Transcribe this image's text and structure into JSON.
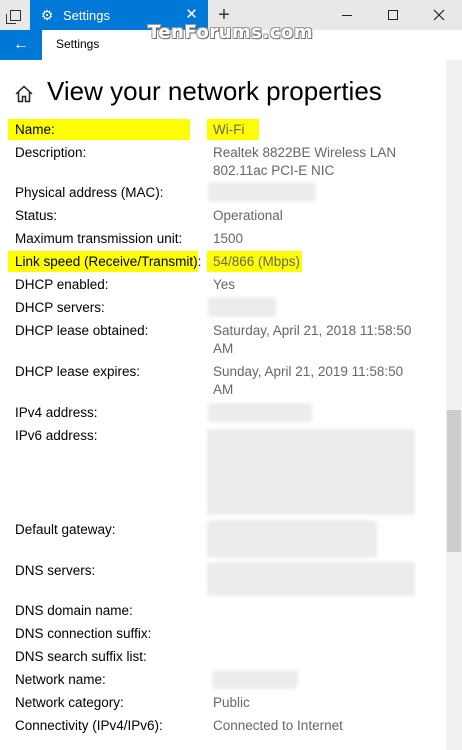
{
  "window": {
    "tab_title": "Settings",
    "new_tab": "+",
    "close_tab": "✕"
  },
  "nav": {
    "back": "←",
    "title": "Settings"
  },
  "watermark": "TenForums.com",
  "page": {
    "title": "View your network properties"
  },
  "properties": [
    {
      "label": "Name:",
      "value": "Wi-Fi",
      "highlight": true
    },
    {
      "label": "Description:",
      "value": "Realtek 8822BE Wireless LAN 802.11ac PCI-E NIC"
    },
    {
      "label": "Physical address (MAC):",
      "value": "",
      "redacted": true
    },
    {
      "label": "Status:",
      "value": "Operational"
    },
    {
      "label": "Maximum transmission unit:",
      "value": "1500"
    },
    {
      "label": "Link speed (Receive/Transmit):",
      "value": "54/866 (Mbps)",
      "highlight": true
    },
    {
      "label": "DHCP enabled:",
      "value": "Yes"
    },
    {
      "label": "DHCP servers:",
      "value": "",
      "redacted": true
    },
    {
      "label": "DHCP lease obtained:",
      "value": "Saturday, April 21, 2018 11:58:50 AM"
    },
    {
      "label": "DHCP lease expires:",
      "value": "Sunday, April 21, 2019 11:58:50 AM"
    },
    {
      "label": "IPv4 address:",
      "value": "",
      "redacted": true
    },
    {
      "label": "IPv6 address:",
      "value": "",
      "redacted": true
    },
    {
      "label": "Default gateway:",
      "value": "",
      "redacted": true
    },
    {
      "label": "DNS servers:",
      "value": "",
      "redacted": true
    },
    {
      "label": "DNS domain name:",
      "value": ""
    },
    {
      "label": "DNS connection suffix:",
      "value": ""
    },
    {
      "label": "DNS search suffix list:",
      "value": ""
    },
    {
      "label": "Network name:",
      "value": "",
      "redacted": true
    },
    {
      "label": "Network category:",
      "value": "Public"
    },
    {
      "label": "Connectivity (IPv4/IPv6):",
      "value": "Connected to Internet"
    }
  ],
  "colors": {
    "accent": "#0078d7",
    "highlight": "#ffff00",
    "value_text": "#666666"
  }
}
